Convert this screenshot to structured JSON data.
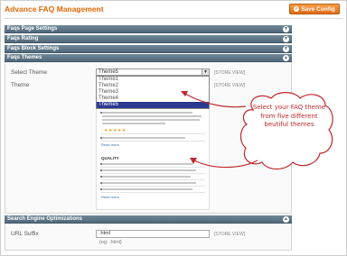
{
  "page_title": "Advance FAQ Management",
  "save_button": "Save Config",
  "sections": [
    {
      "label": "Faqs Page Settings"
    },
    {
      "label": "Faqs Rating"
    },
    {
      "label": "Faqs Block Settings"
    },
    {
      "label": "Faqs Themes"
    },
    {
      "label": "Search Engine Optimizations"
    }
  ],
  "themes": {
    "select_label": "Select Theme",
    "theme_label": "Theme",
    "selected_value": "Theme5",
    "scope": "[STORE VIEW]",
    "options": [
      "Theme1",
      "Theme2",
      "Theme3",
      "Theme4",
      "Theme5"
    ],
    "preview": {
      "read_more": "Read more",
      "stars": "★★★★★",
      "quality_heading": "QUALITY"
    }
  },
  "seo": {
    "url_suffix_label": "URL Suffix",
    "url_suffix_value": ".html",
    "url_suffix_hint": "(eg: .html)",
    "scope": "[STORE VIEW]"
  },
  "callout": {
    "text": "Select your FAQ theme from five different beutiful themes",
    "color": "#c0282d"
  },
  "colors": {
    "accent": "#e26703",
    "section_header": "#51697a",
    "selected_option": "#2b3990"
  }
}
